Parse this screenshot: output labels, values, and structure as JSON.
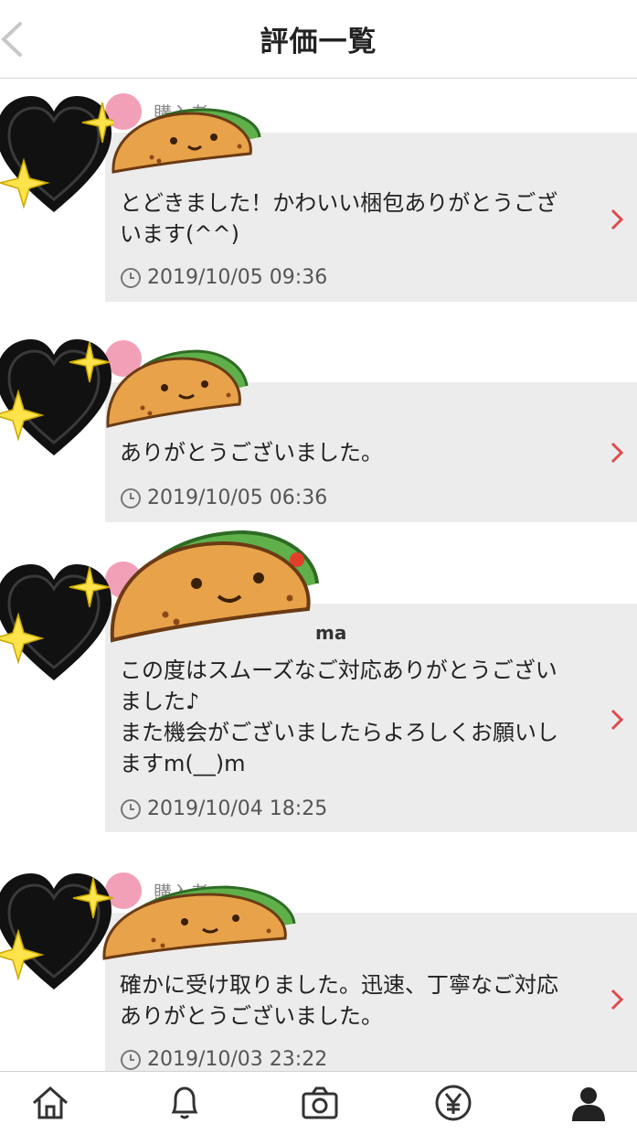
{
  "header": {
    "title": "評価一覧"
  },
  "reviews": [
    {
      "role": "購入者",
      "user": "",
      "comment": "とどきました！かわいい梱包ありがとうございます(^^)",
      "date": "2019/10/05 09:36"
    },
    {
      "role": "",
      "user": "",
      "comment": "ありがとうございました。",
      "date": "2019/10/05 06:36"
    },
    {
      "role": "",
      "user": "ma",
      "comment": "この度はスムーズなご対応ありがとうございました♪\nまた機会がございましたらよろしくお願いしますm(__)m",
      "date": "2019/10/04 18:25"
    },
    {
      "role": "購入者",
      "user": "",
      "comment": "確かに受け取りました。迅速、丁寧なご対応ありがとうございました。",
      "date": "2019/10/03 23:22"
    }
  ],
  "tabbar": {
    "items": [
      "home-icon",
      "bell-icon",
      "camera-icon",
      "yen-icon",
      "person-icon"
    ]
  },
  "colors": {
    "accent": "#e04a4a",
    "card_bg": "#ececec",
    "avatar_pink": "#f2a0b8"
  }
}
